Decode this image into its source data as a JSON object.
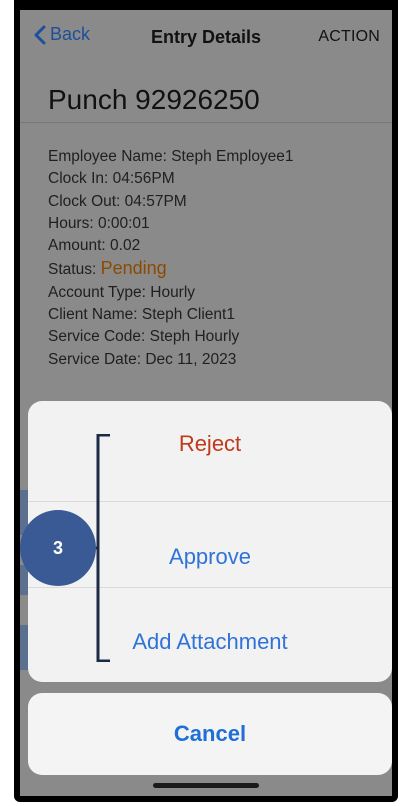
{
  "nav": {
    "back_label": "Back",
    "title": "Entry Details",
    "action_label": "ACTION"
  },
  "punch": {
    "title": "Punch 92926250"
  },
  "details": {
    "employee_name": "Employee Name: Steph Employee1",
    "clock_in": "Clock In: 04:56PM",
    "clock_out": "Clock Out: 04:57PM",
    "hours": "Hours: 0:00:01",
    "amount": "Amount: 0.02",
    "status_label": "Status: ",
    "status_value": "Pending",
    "account_type": "Account Type: Hourly",
    "client_name": "Client Name: Steph Client1",
    "service_code": "Service Code: Steph Hourly",
    "service_date": "Service Date: Dec 11, 2023"
  },
  "action_sheet": {
    "items": [
      {
        "label": "Reject"
      },
      {
        "label": "Approve"
      },
      {
        "label": "Add Attachment"
      }
    ],
    "cancel_label": "Cancel"
  },
  "annotation": {
    "step_number": "3"
  },
  "colors": {
    "status_pending": "#8a4b00",
    "reject": "#c0391b",
    "action_blue": "#2f73d8",
    "badge": "#3a5a95"
  }
}
